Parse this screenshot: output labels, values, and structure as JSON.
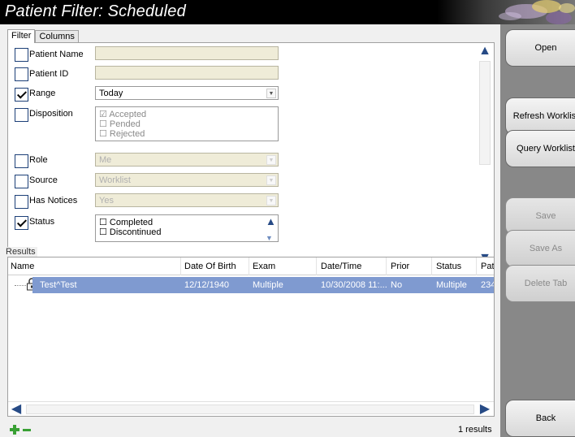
{
  "window": {
    "title": "Patient Filter: Scheduled"
  },
  "tabs": [
    {
      "label": "Filter"
    },
    {
      "label": "Columns"
    }
  ],
  "filters": {
    "patient_name": {
      "label": "Patient Name",
      "checked": false,
      "value": ""
    },
    "patient_id": {
      "label": "Patient ID",
      "checked": false,
      "value": ""
    },
    "range": {
      "label": "Range",
      "checked": true,
      "value": "Today"
    },
    "disposition": {
      "label": "Disposition",
      "checked": false,
      "options": [
        "Accepted",
        "Pended",
        "Rejected"
      ]
    },
    "role": {
      "label": "Role",
      "checked": false,
      "value": "Me"
    },
    "source": {
      "label": "Source",
      "checked": false,
      "value": "Worklist"
    },
    "has_notices": {
      "label": "Has Notices",
      "checked": false,
      "value": "Yes"
    },
    "status": {
      "label": "Status",
      "checked": true,
      "options": [
        "Completed",
        "Discontinued"
      ]
    }
  },
  "results": {
    "label": "Results",
    "columns": [
      "Name",
      "Date Of Birth",
      "Exam",
      "Date/Time",
      "Prior",
      "Status",
      "Pat"
    ],
    "rows": [
      {
        "name": "Test^Test",
        "dob": "12/12/1940",
        "exam": "Multiple",
        "datetime": "10/30/2008 11:...",
        "prior": "No",
        "status": "Multiple",
        "pat": "234"
      }
    ],
    "count": "1 results"
  },
  "buttons": {
    "open": "Open",
    "refresh": "Refresh Worklist",
    "query": "Query Worklist",
    "save": "Save",
    "save_as": "Save As",
    "delete_tab": "Delete Tab",
    "back": "Back"
  },
  "icons": [
    "lock-icon",
    "add-icon",
    "remove-icon",
    "scroll-up-icon",
    "scroll-down-icon",
    "scroll-left-icon",
    "scroll-right-icon",
    "dropdown-arrow-icon"
  ]
}
